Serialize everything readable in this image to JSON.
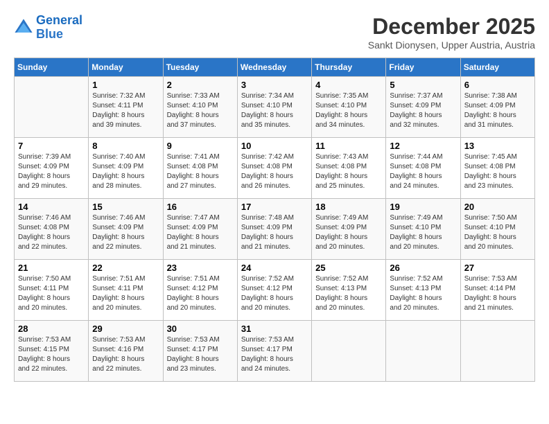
{
  "header": {
    "logo_line1": "General",
    "logo_line2": "Blue",
    "month_title": "December 2025",
    "subtitle": "Sankt Dionysen, Upper Austria, Austria"
  },
  "days_of_week": [
    "Sunday",
    "Monday",
    "Tuesday",
    "Wednesday",
    "Thursday",
    "Friday",
    "Saturday"
  ],
  "weeks": [
    [
      {
        "day": "",
        "info": ""
      },
      {
        "day": "1",
        "info": "Sunrise: 7:32 AM\nSunset: 4:11 PM\nDaylight: 8 hours\nand 39 minutes."
      },
      {
        "day": "2",
        "info": "Sunrise: 7:33 AM\nSunset: 4:10 PM\nDaylight: 8 hours\nand 37 minutes."
      },
      {
        "day": "3",
        "info": "Sunrise: 7:34 AM\nSunset: 4:10 PM\nDaylight: 8 hours\nand 35 minutes."
      },
      {
        "day": "4",
        "info": "Sunrise: 7:35 AM\nSunset: 4:10 PM\nDaylight: 8 hours\nand 34 minutes."
      },
      {
        "day": "5",
        "info": "Sunrise: 7:37 AM\nSunset: 4:09 PM\nDaylight: 8 hours\nand 32 minutes."
      },
      {
        "day": "6",
        "info": "Sunrise: 7:38 AM\nSunset: 4:09 PM\nDaylight: 8 hours\nand 31 minutes."
      }
    ],
    [
      {
        "day": "7",
        "info": "Sunrise: 7:39 AM\nSunset: 4:09 PM\nDaylight: 8 hours\nand 29 minutes."
      },
      {
        "day": "8",
        "info": "Sunrise: 7:40 AM\nSunset: 4:09 PM\nDaylight: 8 hours\nand 28 minutes."
      },
      {
        "day": "9",
        "info": "Sunrise: 7:41 AM\nSunset: 4:08 PM\nDaylight: 8 hours\nand 27 minutes."
      },
      {
        "day": "10",
        "info": "Sunrise: 7:42 AM\nSunset: 4:08 PM\nDaylight: 8 hours\nand 26 minutes."
      },
      {
        "day": "11",
        "info": "Sunrise: 7:43 AM\nSunset: 4:08 PM\nDaylight: 8 hours\nand 25 minutes."
      },
      {
        "day": "12",
        "info": "Sunrise: 7:44 AM\nSunset: 4:08 PM\nDaylight: 8 hours\nand 24 minutes."
      },
      {
        "day": "13",
        "info": "Sunrise: 7:45 AM\nSunset: 4:08 PM\nDaylight: 8 hours\nand 23 minutes."
      }
    ],
    [
      {
        "day": "14",
        "info": "Sunrise: 7:46 AM\nSunset: 4:08 PM\nDaylight: 8 hours\nand 22 minutes."
      },
      {
        "day": "15",
        "info": "Sunrise: 7:46 AM\nSunset: 4:09 PM\nDaylight: 8 hours\nand 22 minutes."
      },
      {
        "day": "16",
        "info": "Sunrise: 7:47 AM\nSunset: 4:09 PM\nDaylight: 8 hours\nand 21 minutes."
      },
      {
        "day": "17",
        "info": "Sunrise: 7:48 AM\nSunset: 4:09 PM\nDaylight: 8 hours\nand 21 minutes."
      },
      {
        "day": "18",
        "info": "Sunrise: 7:49 AM\nSunset: 4:09 PM\nDaylight: 8 hours\nand 20 minutes."
      },
      {
        "day": "19",
        "info": "Sunrise: 7:49 AM\nSunset: 4:10 PM\nDaylight: 8 hours\nand 20 minutes."
      },
      {
        "day": "20",
        "info": "Sunrise: 7:50 AM\nSunset: 4:10 PM\nDaylight: 8 hours\nand 20 minutes."
      }
    ],
    [
      {
        "day": "21",
        "info": "Sunrise: 7:50 AM\nSunset: 4:11 PM\nDaylight: 8 hours\nand 20 minutes."
      },
      {
        "day": "22",
        "info": "Sunrise: 7:51 AM\nSunset: 4:11 PM\nDaylight: 8 hours\nand 20 minutes."
      },
      {
        "day": "23",
        "info": "Sunrise: 7:51 AM\nSunset: 4:12 PM\nDaylight: 8 hours\nand 20 minutes."
      },
      {
        "day": "24",
        "info": "Sunrise: 7:52 AM\nSunset: 4:12 PM\nDaylight: 8 hours\nand 20 minutes."
      },
      {
        "day": "25",
        "info": "Sunrise: 7:52 AM\nSunset: 4:13 PM\nDaylight: 8 hours\nand 20 minutes."
      },
      {
        "day": "26",
        "info": "Sunrise: 7:52 AM\nSunset: 4:13 PM\nDaylight: 8 hours\nand 20 minutes."
      },
      {
        "day": "27",
        "info": "Sunrise: 7:53 AM\nSunset: 4:14 PM\nDaylight: 8 hours\nand 21 minutes."
      }
    ],
    [
      {
        "day": "28",
        "info": "Sunrise: 7:53 AM\nSunset: 4:15 PM\nDaylight: 8 hours\nand 22 minutes."
      },
      {
        "day": "29",
        "info": "Sunrise: 7:53 AM\nSunset: 4:16 PM\nDaylight: 8 hours\nand 22 minutes."
      },
      {
        "day": "30",
        "info": "Sunrise: 7:53 AM\nSunset: 4:17 PM\nDaylight: 8 hours\nand 23 minutes."
      },
      {
        "day": "31",
        "info": "Sunrise: 7:53 AM\nSunset: 4:17 PM\nDaylight: 8 hours\nand 24 minutes."
      },
      {
        "day": "",
        "info": ""
      },
      {
        "day": "",
        "info": ""
      },
      {
        "day": "",
        "info": ""
      }
    ]
  ]
}
